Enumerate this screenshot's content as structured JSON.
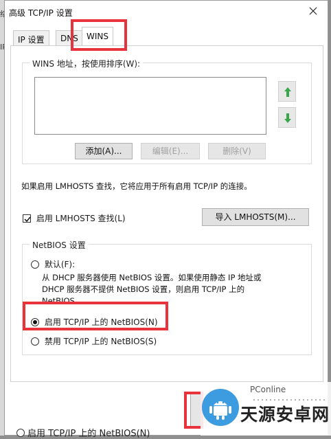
{
  "dialog": {
    "title": "高级 TCP/IP 设置"
  },
  "tabs": [
    {
      "label": "IP 设置",
      "active": false
    },
    {
      "label": "DNS",
      "active": false
    },
    {
      "label": "WINS",
      "active": true
    }
  ],
  "wins": {
    "group_label": "WINS 地址，按使用排序(W):",
    "add_button": "添加(A)...",
    "edit_button": "编辑(E)...",
    "delete_button": "删除(V)",
    "up_icon": "arrow-up-icon",
    "down_icon": "arrow-down-icon"
  },
  "lmhosts": {
    "info": "如果启用 LMHOSTS 查找，它将应用于所有启用 TCP/IP 的连接。",
    "checkbox_label": "启用 LMHOSTS 查找(L)",
    "checked": true,
    "import_button": "导入 LMHOSTS(M)..."
  },
  "netbios": {
    "group_label": "NetBIOS 设置",
    "default_label": "默认(F):",
    "default_desc_lines": [
      "从 DHCP 服务器使用 NetBIOS 设置。如果使用静态 IP 地址或",
      "DHCP 服务器不提供 NetBIOS 设置，则启用 TCP/IP 上的",
      "NetBIOS。"
    ],
    "enable_label": "启用 TCP/IP 上的 NetBIOS(N)",
    "disable_label": "禁用 TCP/IP 上的 NetBIOS(S)",
    "selected": "enable"
  },
  "background": {
    "radio_label": "启用 TCP/IP 上的 NetBIOS(N)",
    "left_chars": [
      "络",
      "IP"
    ]
  },
  "watermark": {
    "small_text": "PConline",
    "big_text": "天源安卓网"
  },
  "colors": {
    "highlight": "#e8323c",
    "logo_blue": "#3d9be0",
    "arrow_green": "#3aa64a"
  }
}
